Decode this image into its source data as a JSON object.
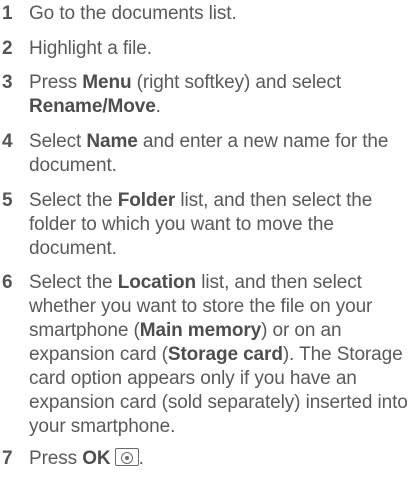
{
  "steps": [
    {
      "num": "1",
      "parts": [
        {
          "t": "Go to the documents list."
        }
      ]
    },
    {
      "num": "2",
      "parts": [
        {
          "t": "Highlight a file."
        }
      ]
    },
    {
      "num": "3",
      "parts": [
        {
          "t": "Press "
        },
        {
          "t": "Menu",
          "b": true
        },
        {
          "t": " (right softkey) and select "
        },
        {
          "t": "Rename/Move",
          "b": true
        },
        {
          "t": "."
        }
      ]
    },
    {
      "num": "4",
      "parts": [
        {
          "t": "Select "
        },
        {
          "t": "Name",
          "b": true
        },
        {
          "t": " and enter a new name for the document."
        }
      ]
    },
    {
      "num": "5",
      "parts": [
        {
          "t": "Select the "
        },
        {
          "t": "Folder",
          "b": true
        },
        {
          "t": " list, and then select the folder to which you want to move the document."
        }
      ]
    },
    {
      "num": "6",
      "parts": [
        {
          "t": "Select the "
        },
        {
          "t": "Location",
          "b": true
        },
        {
          "t": " list, and then select whether you want to store the file on your smartphone ("
        },
        {
          "t": "Main memory",
          "b": true
        },
        {
          "t": ") or on an expansion card ("
        },
        {
          "t": "Storage card",
          "b": true
        },
        {
          "t": "). The Storage card option appears only if you have an expansion card (sold separately) inserted into your smartphone."
        }
      ]
    },
    {
      "num": "7",
      "parts": [
        {
          "t": "Press "
        },
        {
          "t": "OK",
          "b": true
        },
        {
          "icon": "ok-key-icon"
        },
        {
          "t": "."
        }
      ]
    }
  ]
}
